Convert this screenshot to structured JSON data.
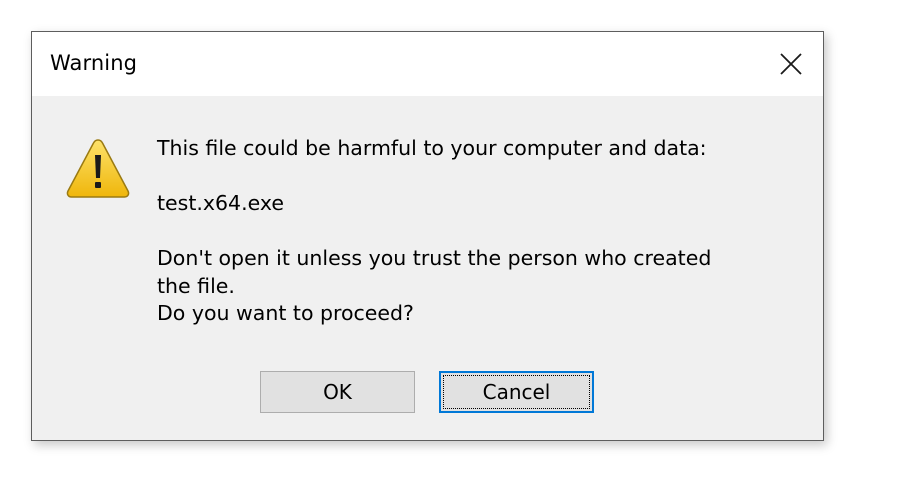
{
  "dialog": {
    "title": "Warning",
    "icon": "warning-triangle-icon",
    "close_icon": "close-icon",
    "messages": [
      "This file could be harmful to your computer and data:",
      "test.x64.exe",
      "Don't open it unless you trust the person who created",
      "the file.",
      "Do you want to proceed?"
    ],
    "buttons": {
      "ok": "OK",
      "cancel": "Cancel"
    },
    "focused_button": "cancel",
    "colors": {
      "focus_border": "#0078d7",
      "warning_fill": "#f5c518",
      "titlebar_bg": "#ffffff",
      "body_bg": "#f0f0f0"
    }
  }
}
